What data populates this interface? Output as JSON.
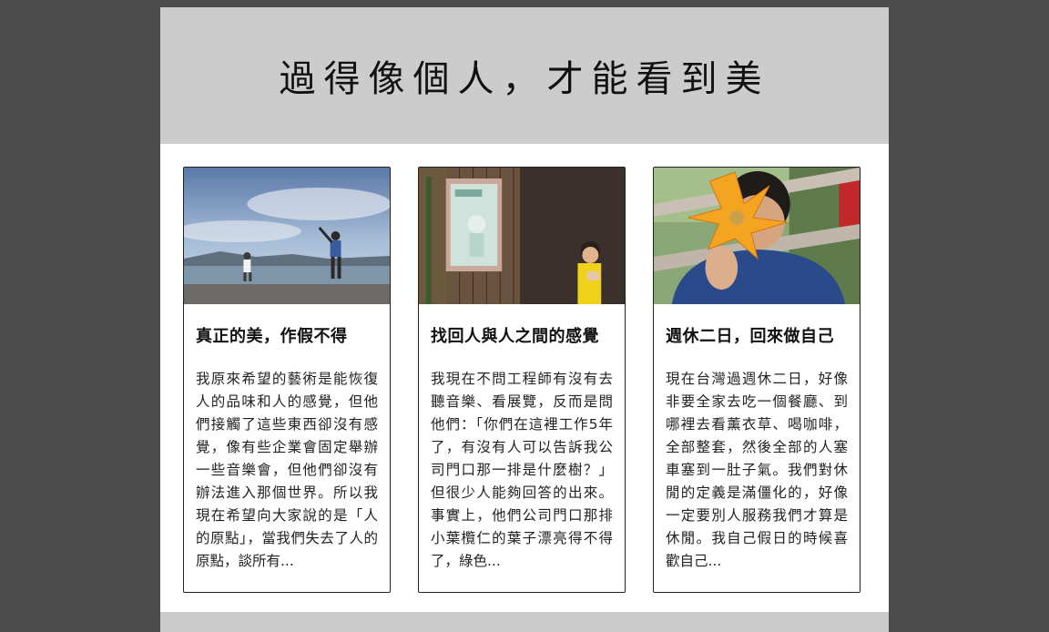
{
  "header": {
    "title": "過得像個人，才能看到美"
  },
  "cards": [
    {
      "title": "真正的美，作假不得",
      "excerpt": "我原來希望的藝術是能恢復人的品味和人的感覺，但他們接觸了這些東西卻沒有感覺，像有些企業會固定舉辦一些音樂會，但他們卻沒有辦法進入那個世界。所以我現在希望向大家說的是「人的原點」，當我們失去了人的原點，談所有..."
    },
    {
      "title": "找回人與人之間的感覺",
      "excerpt": "我現在不問工程師有沒有去聽音樂、看展覽，反而是問他們：「你們在這裡工作5年了，有沒有人可以告訴我公司門口那一排是什麼樹？」但很少人能夠回答的出來。事實上，他們公司門口那排小葉欖仁的葉子漂亮得不得了，綠色..."
    },
    {
      "title": "週休二日，回來做自己",
      "excerpt": "現在台灣過週休二日，好像非要全家去吃一個餐廳、到哪裡去看薰衣草、喝咖啡，全部整套，然後全部的人塞車塞到一肚子氣。我們對休閒的定義是滿僵化的，好像一定要別人服務我們才算是休閒。我自己假日的時候喜歡自己..."
    }
  ]
}
